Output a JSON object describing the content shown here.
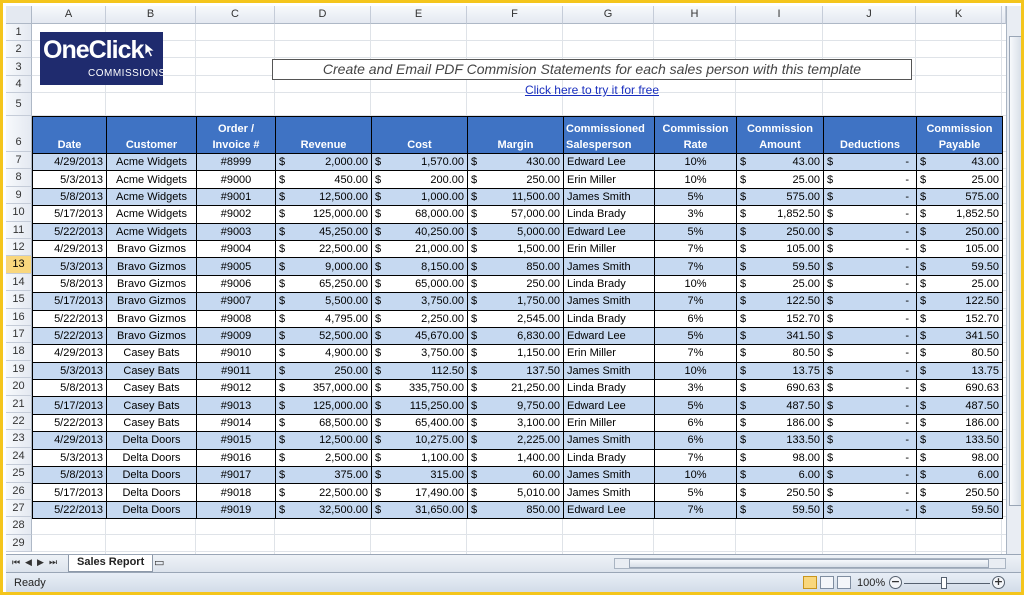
{
  "columns": [
    "A",
    "B",
    "C",
    "D",
    "E",
    "F",
    "G",
    "H",
    "I",
    "J",
    "K"
  ],
  "rows": [
    "1",
    "2",
    "3",
    "4",
    "5",
    "6",
    "7",
    "8",
    "9",
    "10",
    "11",
    "12",
    "13",
    "14",
    "15",
    "16",
    "17",
    "18",
    "19",
    "20",
    "21",
    "22",
    "23",
    "24",
    "25",
    "26",
    "27",
    "28",
    "29"
  ],
  "active_row": "13",
  "logo": {
    "line1": "OneClick",
    "line2": "COMMISSIONS"
  },
  "banner": "Create and Email PDF Commision Statements for each sales person with this template",
  "link": "Click here to try it for free",
  "headers": [
    "Date",
    "Customer",
    "Order / Invoice #",
    "Revenue",
    "Cost",
    "Margin",
    "Commissioned Salesperson",
    "Commission Rate",
    "Commission Amount",
    "Deductions",
    "Commission Payable"
  ],
  "currency": "$",
  "table": [
    [
      "4/29/2013",
      "Acme Widgets",
      "#8999",
      "2,000.00",
      "1,570.00",
      "430.00",
      "Edward Lee",
      "10%",
      "43.00",
      "-",
      "43.00"
    ],
    [
      "5/3/2013",
      "Acme Widgets",
      "#9000",
      "450.00",
      "200.00",
      "250.00",
      "Erin Miller",
      "10%",
      "25.00",
      "-",
      "25.00"
    ],
    [
      "5/8/2013",
      "Acme Widgets",
      "#9001",
      "12,500.00",
      "1,000.00",
      "11,500.00",
      "James Smith",
      "5%",
      "575.00",
      "-",
      "575.00"
    ],
    [
      "5/17/2013",
      "Acme Widgets",
      "#9002",
      "125,000.00",
      "68,000.00",
      "57,000.00",
      "Linda Brady",
      "3%",
      "1,852.50",
      "-",
      "1,852.50"
    ],
    [
      "5/22/2013",
      "Acme Widgets",
      "#9003",
      "45,250.00",
      "40,250.00",
      "5,000.00",
      "Edward Lee",
      "5%",
      "250.00",
      "-",
      "250.00"
    ],
    [
      "4/29/2013",
      "Bravo Gizmos",
      "#9004",
      "22,500.00",
      "21,000.00",
      "1,500.00",
      "Erin Miller",
      "7%",
      "105.00",
      "-",
      "105.00"
    ],
    [
      "5/3/2013",
      "Bravo Gizmos",
      "#9005",
      "9,000.00",
      "8,150.00",
      "850.00",
      "James Smith",
      "7%",
      "59.50",
      "-",
      "59.50"
    ],
    [
      "5/8/2013",
      "Bravo Gizmos",
      "#9006",
      "65,250.00",
      "65,000.00",
      "250.00",
      "Linda Brady",
      "10%",
      "25.00",
      "-",
      "25.00"
    ],
    [
      "5/17/2013",
      "Bravo Gizmos",
      "#9007",
      "5,500.00",
      "3,750.00",
      "1,750.00",
      "James Smith",
      "7%",
      "122.50",
      "-",
      "122.50"
    ],
    [
      "5/22/2013",
      "Bravo Gizmos",
      "#9008",
      "4,795.00",
      "2,250.00",
      "2,545.00",
      "Linda Brady",
      "6%",
      "152.70",
      "-",
      "152.70"
    ],
    [
      "5/22/2013",
      "Bravo Gizmos",
      "#9009",
      "52,500.00",
      "45,670.00",
      "6,830.00",
      "Edward Lee",
      "5%",
      "341.50",
      "-",
      "341.50"
    ],
    [
      "4/29/2013",
      "Casey Bats",
      "#9010",
      "4,900.00",
      "3,750.00",
      "1,150.00",
      "Erin Miller",
      "7%",
      "80.50",
      "-",
      "80.50"
    ],
    [
      "5/3/2013",
      "Casey Bats",
      "#9011",
      "250.00",
      "112.50",
      "137.50",
      "James Smith",
      "10%",
      "13.75",
      "-",
      "13.75"
    ],
    [
      "5/8/2013",
      "Casey Bats",
      "#9012",
      "357,000.00",
      "335,750.00",
      "21,250.00",
      "Linda Brady",
      "3%",
      "690.63",
      "-",
      "690.63"
    ],
    [
      "5/17/2013",
      "Casey Bats",
      "#9013",
      "125,000.00",
      "115,250.00",
      "9,750.00",
      "Edward Lee",
      "5%",
      "487.50",
      "-",
      "487.50"
    ],
    [
      "5/22/2013",
      "Casey Bats",
      "#9014",
      "68,500.00",
      "65,400.00",
      "3,100.00",
      "Erin Miller",
      "6%",
      "186.00",
      "-",
      "186.00"
    ],
    [
      "4/29/2013",
      "Delta Doors",
      "#9015",
      "12,500.00",
      "10,275.00",
      "2,225.00",
      "James Smith",
      "6%",
      "133.50",
      "-",
      "133.50"
    ],
    [
      "5/3/2013",
      "Delta Doors",
      "#9016",
      "2,500.00",
      "1,100.00",
      "1,400.00",
      "Linda Brady",
      "7%",
      "98.00",
      "-",
      "98.00"
    ],
    [
      "5/8/2013",
      "Delta Doors",
      "#9017",
      "375.00",
      "315.00",
      "60.00",
      "James Smith",
      "10%",
      "6.00",
      "-",
      "6.00"
    ],
    [
      "5/17/2013",
      "Delta Doors",
      "#9018",
      "22,500.00",
      "17,490.00",
      "5,010.00",
      "James Smith",
      "5%",
      "250.50",
      "-",
      "250.50"
    ],
    [
      "5/22/2013",
      "Delta Doors",
      "#9019",
      "32,500.00",
      "31,650.00",
      "850.00",
      "Edward Lee",
      "7%",
      "59.50",
      "-",
      "59.50"
    ]
  ],
  "sheet_tab": "Sales Report",
  "status": {
    "ready": "Ready",
    "zoom": "100%"
  }
}
